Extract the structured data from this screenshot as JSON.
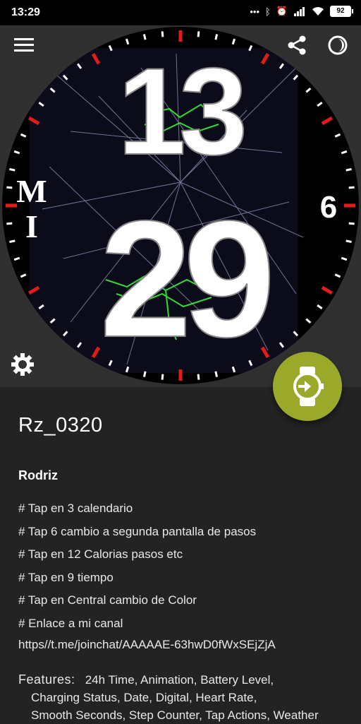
{
  "status_bar": {
    "time": "13:29",
    "battery": "92"
  },
  "watch_face": {
    "hours": "13",
    "minutes": "29",
    "left_logo_top": "M",
    "left_logo_bottom": "I",
    "dial_number_6": "6",
    "accent_color": "#e21b1b",
    "bolt_color": "#3bff3b"
  },
  "toolbar": {
    "menu_icon": "menu-icon",
    "share_icon": "share-icon",
    "theme_icon": "theme-icon",
    "settings_icon": "gear-icon"
  },
  "detail": {
    "title": "Rz_0320",
    "author": "Rodriz",
    "lines": [
      "# Tap en 3 calendario",
      "# Tap 6 cambio a segunda pantalla de pasos",
      "# Tap en 12 Calorias pasos etc",
      "# Tap en 9 tiempo",
      "# Tap en Central cambio de Color",
      "# Enlace a mi canal"
    ],
    "link": "https//t.me/joinchat/AAAAAE-63hwD0fWxSEjZjA",
    "features_label": "Features:",
    "features_row1": "24h Time,  Animation,  Battery Level,",
    "features_row2": "Charging Status,  Date,  Digital,  Heart Rate,",
    "features_row3": "Smooth Seconds,  Step Counter,  Tap Actions,  Weather"
  },
  "fab": {
    "icon": "watch-apply-icon",
    "color": "#9aa92a"
  }
}
